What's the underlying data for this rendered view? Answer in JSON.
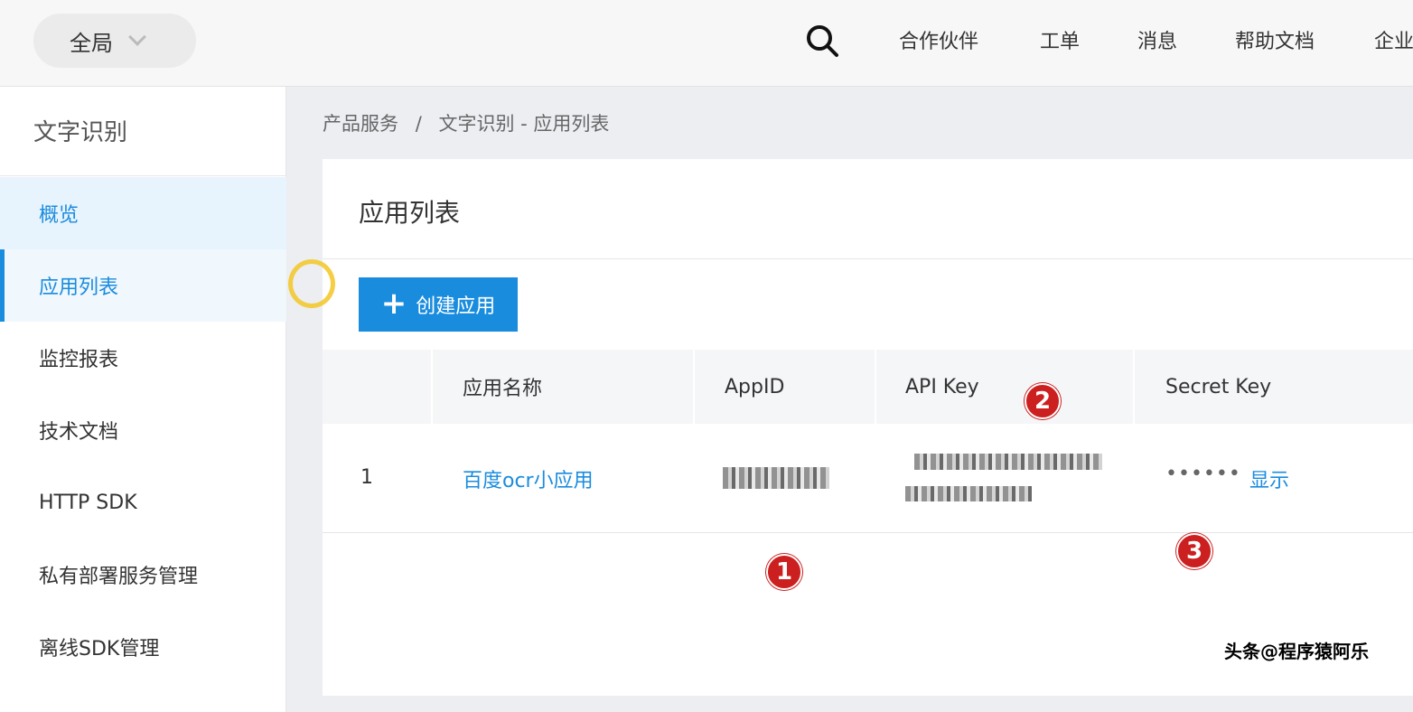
{
  "topbar": {
    "scope_label": "全局",
    "nav": [
      "合作伙伴",
      "工单",
      "消息",
      "帮助文档",
      "企业"
    ]
  },
  "sidebar": {
    "title": "文字识别",
    "items": [
      {
        "label": "概览"
      },
      {
        "label": "应用列表"
      },
      {
        "label": "监控报表"
      },
      {
        "label": "技术文档"
      },
      {
        "label": "HTTP SDK"
      },
      {
        "label": "私有部署服务管理"
      },
      {
        "label": "离线SDK管理"
      }
    ]
  },
  "breadcrumb": {
    "root": "产品服务",
    "separator": "/",
    "current": "文字识别 - 应用列表"
  },
  "main": {
    "title": "应用列表",
    "create_button": "创建应用"
  },
  "table": {
    "headers": [
      "",
      "应用名称",
      "AppID",
      "API Key",
      "Secret Key"
    ],
    "rows": [
      {
        "index": "1",
        "name": "百度ocr小应用",
        "secret_mask": "••••••",
        "show_label": "显示"
      }
    ]
  },
  "annotations": [
    "1",
    "2",
    "3"
  ],
  "watermark": "头条@程序猿阿乐",
  "colors": {
    "accent": "#1a8cde",
    "badge": "#cc1f1f",
    "cursor": "#f3c623"
  }
}
